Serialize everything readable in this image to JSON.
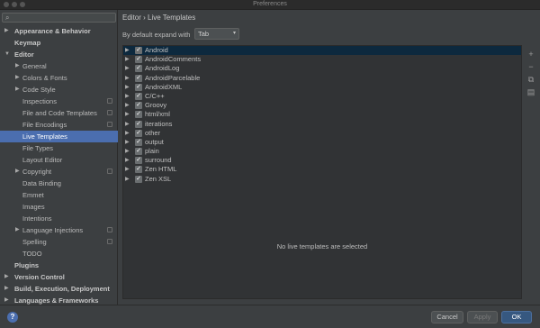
{
  "window": {
    "title": "Preferences"
  },
  "sidebar": {
    "items": [
      {
        "label": "Appearance & Behavior",
        "level": 0,
        "arrow": "▶",
        "bold": true
      },
      {
        "label": "Keymap",
        "level": 0,
        "arrow": "",
        "bold": true
      },
      {
        "label": "Editor",
        "level": 0,
        "arrow": "▼",
        "bold": true
      },
      {
        "label": "General",
        "level": 1,
        "arrow": "▶"
      },
      {
        "label": "Colors & Fonts",
        "level": 1,
        "arrow": "▶"
      },
      {
        "label": "Code Style",
        "level": 1,
        "arrow": "▶"
      },
      {
        "label": "Inspections",
        "level": 1,
        "arrow": "",
        "project": true
      },
      {
        "label": "File and Code Templates",
        "level": 1,
        "arrow": "",
        "project": true
      },
      {
        "label": "File Encodings",
        "level": 1,
        "arrow": "",
        "project": true
      },
      {
        "label": "Live Templates",
        "level": 1,
        "arrow": "",
        "selected": true
      },
      {
        "label": "File Types",
        "level": 1,
        "arrow": ""
      },
      {
        "label": "Layout Editor",
        "level": 1,
        "arrow": ""
      },
      {
        "label": "Copyright",
        "level": 1,
        "arrow": "▶",
        "project": true
      },
      {
        "label": "Data Binding",
        "level": 1,
        "arrow": ""
      },
      {
        "label": "Emmet",
        "level": 1,
        "arrow": ""
      },
      {
        "label": "Images",
        "level": 1,
        "arrow": ""
      },
      {
        "label": "Intentions",
        "level": 1,
        "arrow": ""
      },
      {
        "label": "Language Injections",
        "level": 1,
        "arrow": "▶",
        "project": true
      },
      {
        "label": "Spelling",
        "level": 1,
        "arrow": "",
        "project": true
      },
      {
        "label": "TODO",
        "level": 1,
        "arrow": ""
      },
      {
        "label": "Plugins",
        "level": 0,
        "arrow": "",
        "bold": true
      },
      {
        "label": "Version Control",
        "level": 0,
        "arrow": "▶",
        "bold": true
      },
      {
        "label": "Build, Execution, Deployment",
        "level": 0,
        "arrow": "▶",
        "bold": true
      },
      {
        "label": "Languages & Frameworks",
        "level": 0,
        "arrow": "▶",
        "bold": true
      }
    ]
  },
  "main": {
    "breadcrumb": "Editor › Live Templates",
    "expand_label": "By default expand with",
    "expand_value": "Tab",
    "templates": [
      {
        "name": "Android",
        "selected": true
      },
      {
        "name": "AndroidComments"
      },
      {
        "name": "AndroidLog"
      },
      {
        "name": "AndroidParcelable"
      },
      {
        "name": "AndroidXML"
      },
      {
        "name": "C/C++"
      },
      {
        "name": "Groovy"
      },
      {
        "name": "html/xml"
      },
      {
        "name": "iterations"
      },
      {
        "name": "other"
      },
      {
        "name": "output"
      },
      {
        "name": "plain"
      },
      {
        "name": "surround"
      },
      {
        "name": "Zen HTML"
      },
      {
        "name": "Zen XSL"
      }
    ],
    "empty_message": "No live templates are selected",
    "tools": [
      "+",
      "−",
      "⧉",
      "▤"
    ]
  },
  "footer": {
    "help": "?",
    "cancel": "Cancel",
    "apply": "Apply",
    "ok": "OK"
  },
  "colors": {
    "background": "#3c3f41",
    "selection": "#4b6eaf",
    "primary_button": "#365880"
  }
}
